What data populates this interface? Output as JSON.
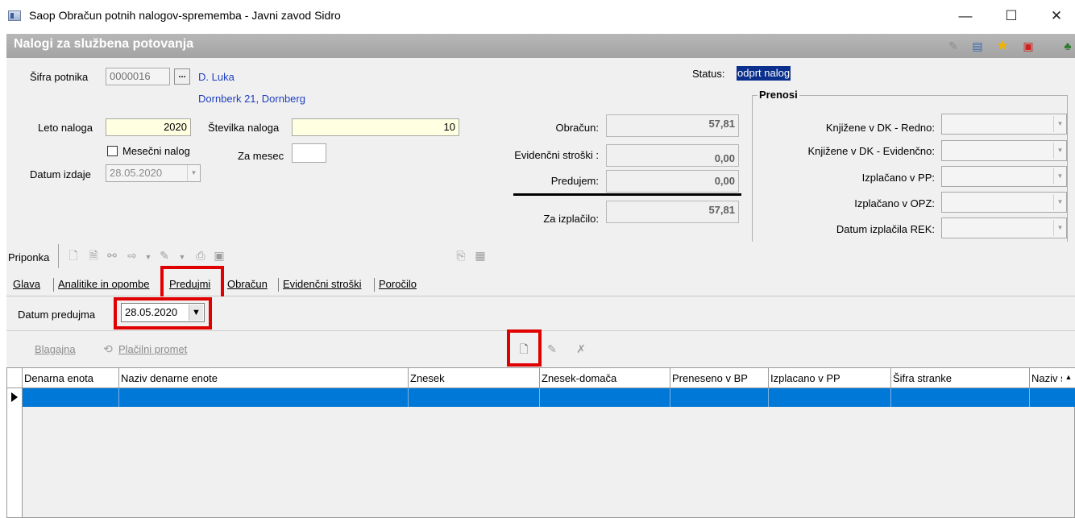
{
  "window": {
    "title": "Saop Obračun potnih nalogov-sprememba - Javni zavod Sidro",
    "minimize": "—",
    "maximize": "☐",
    "close": "✕"
  },
  "header": {
    "title": "Nalogi za službena potovanja",
    "icons": [
      "edit-icon",
      "list-icon",
      "star-icon",
      "pdf-icon",
      "person-icon"
    ]
  },
  "form": {
    "sifra_label": "Šifra potnika",
    "sifra_value": "0000016",
    "dots": "...",
    "traveler_name": "D. Luka",
    "traveler_address": "Dornberk 21, Dornberg",
    "leto_label": "Leto naloga",
    "leto_value": "2020",
    "stevilka_label": "Številka naloga",
    "stevilka_value": "10",
    "mesecni_label": "Mesečni nalog",
    "za_mesec_label": "Za mesec",
    "za_mesec_value": "",
    "datum_izdaje_label": "Datum izdaje",
    "datum_izdaje_value": "28.05.2020",
    "status_label": "Status:",
    "status_value": "odprt nalog"
  },
  "totals": {
    "obracun_label": "Obračun:",
    "obracun_value": "57,81",
    "evidencni_label": "Evidenčni stroški :",
    "evidencni_value": "0,00",
    "predujem_label": "Predujem:",
    "predujem_value": "0,00",
    "izplacilo_label": "Za izplačilo:",
    "izplacilo_value": "57,81"
  },
  "prenosi": {
    "title": "Prenosi",
    "rows": [
      {
        "label": "Knjižene v DK - Redno:",
        "value": ""
      },
      {
        "label": "Knjižene v DK - Evidenčno:",
        "value": ""
      },
      {
        "label": "Izplačano v PP:",
        "value": ""
      },
      {
        "label": "Izplačano v OPZ:",
        "value": ""
      },
      {
        "label": "Datum izplačila REK:",
        "value": ""
      }
    ]
  },
  "attachment": {
    "label": "Priponka"
  },
  "tabs": [
    {
      "label": "Glava"
    },
    {
      "label": "Analitike in opombe"
    },
    {
      "label": "Predujmi"
    },
    {
      "label": "Obračun"
    },
    {
      "label": "Evidenčni stroški"
    },
    {
      "label": "Poročilo"
    }
  ],
  "predujmi": {
    "datum_label": "Datum predujma",
    "datum_value": "28.05.2020",
    "blagajna_label": "Blagajna",
    "placilni_label": "Plačilni promet"
  },
  "grid": {
    "columns": [
      "Denarna enota",
      "Naziv denarne enote",
      "Znesek",
      "Znesek-domača",
      "Preneseno v BP",
      "Izplacano v PP",
      "Šifra stranke",
      "Naziv s"
    ]
  },
  "colors": {
    "header_band": "#a8a8a8",
    "selected_row": "#0078d7",
    "highlight": "#e00000",
    "status_bg": "#0a2f8c"
  }
}
